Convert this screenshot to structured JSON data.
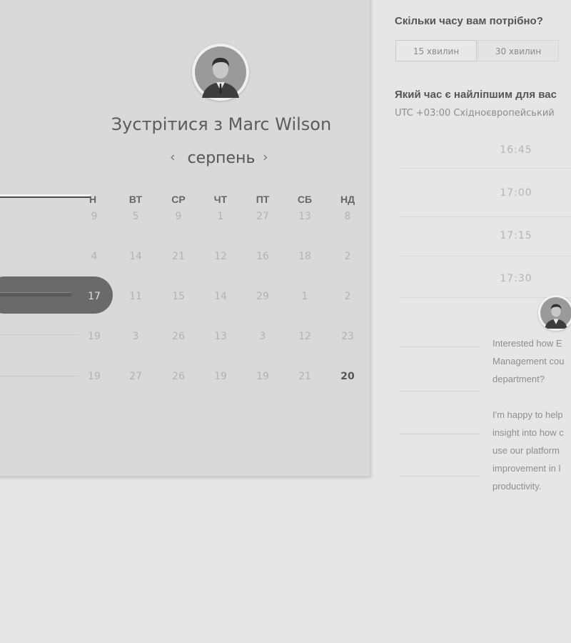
{
  "host": {
    "title": "Зустрітися з Marc Wilson"
  },
  "calendar": {
    "month": "серпень",
    "prev_arrow": "‹",
    "next_arrow": "›",
    "weekdays": [
      "ПН",
      "ВТ",
      "СР",
      "ЧТ",
      "ПТ",
      "СБ",
      "НД"
    ],
    "weekday_first_visible": "Н",
    "weeks": [
      [
        "9",
        "5",
        "9",
        "1",
        "27",
        "13",
        "8"
      ],
      [
        "4",
        "14",
        "21",
        "12",
        "16",
        "18",
        "2"
      ],
      [
        "17",
        "11",
        "15",
        "14",
        "29",
        "1",
        "2"
      ],
      [
        "19",
        "3",
        "26",
        "13",
        "3",
        "12",
        "23"
      ],
      [
        "19",
        "27",
        "26",
        "19",
        "19",
        "21",
        "20"
      ]
    ]
  },
  "duration": {
    "question": "Скільки часу вам потрібно?",
    "options": [
      "15 хвилин",
      "30 хвилин"
    ]
  },
  "time": {
    "question": "Який час є найліпшим для вас",
    "timezone": "UTC +03:00 Східноєвропейський",
    "slots": [
      "16:45",
      "17:00",
      "17:15",
      "17:30"
    ]
  },
  "chat": {
    "lines": [
      "Interested how E",
      "Management cou",
      "department?",
      "",
      "I'm happy to help",
      "insight into how c",
      "use our platform",
      "improvement in l",
      "productivity."
    ]
  }
}
